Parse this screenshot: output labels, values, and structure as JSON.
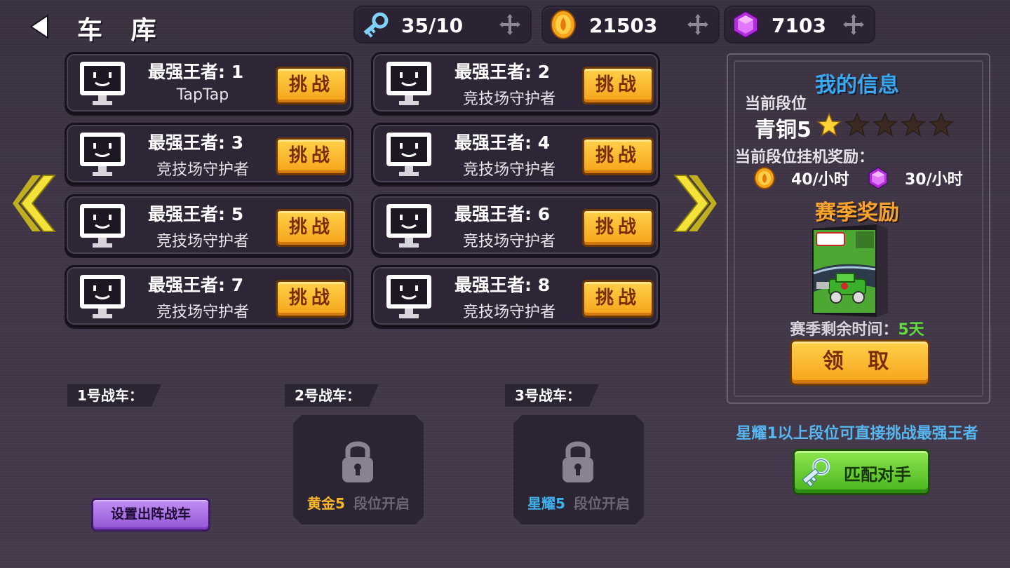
{
  "header": {
    "title": "车 库"
  },
  "resources": {
    "keys": {
      "value": "35/10",
      "icon": "key-icon"
    },
    "coins": {
      "value": "21503",
      "icon": "coin-icon"
    },
    "gems": {
      "value": "7103",
      "icon": "gem-icon"
    }
  },
  "opponents": [
    {
      "name": "最强王者: 1",
      "subtitle": "TapTap",
      "button": "挑战"
    },
    {
      "name": "最强王者: 2",
      "subtitle": "竞技场守护者",
      "button": "挑战"
    },
    {
      "name": "最强王者: 3",
      "subtitle": "竞技场守护者",
      "button": "挑战"
    },
    {
      "name": "最强王者: 4",
      "subtitle": "竞技场守护者",
      "button": "挑战"
    },
    {
      "name": "最强王者: 5",
      "subtitle": "竞技场守护者",
      "button": "挑战"
    },
    {
      "name": "最强王者: 6",
      "subtitle": "竞技场守护者",
      "button": "挑战"
    },
    {
      "name": "最强王者: 7",
      "subtitle": "竞技场守护者",
      "button": "挑战"
    },
    {
      "name": "最强王者: 8",
      "subtitle": "竞技场守护者",
      "button": "挑战"
    }
  ],
  "info": {
    "title": "我的信息",
    "rank_label": "当前段位",
    "rank": "青铜5",
    "stars_filled": 1,
    "stars_total": 5,
    "idle_label": "当前段位挂机奖励：",
    "coin_rate": "40/小时",
    "gem_rate": "30/小时",
    "season_title": "赛季奖励",
    "season_time_label": "赛季剩余时间：",
    "season_days": "5天",
    "claim_button": "领 取",
    "hint": "星耀1以上段位可直接挑战最强王者",
    "match_button": "匹配对手"
  },
  "slots": [
    {
      "label": "1号战车："
    },
    {
      "label": "2号战车：",
      "req_level": "黄金5",
      "req_text": "段位开启"
    },
    {
      "label": "3号战车：",
      "req_level": "星耀5",
      "req_text": "段位开启"
    }
  ],
  "deploy_button": "设置出阵战车",
  "colors": {
    "accent_orange": "#f5a31a",
    "accent_blue": "#3aa9ef",
    "accent_green": "#48b41e",
    "accent_purple": "#9456d6",
    "days_green": "#5fdc3e"
  }
}
